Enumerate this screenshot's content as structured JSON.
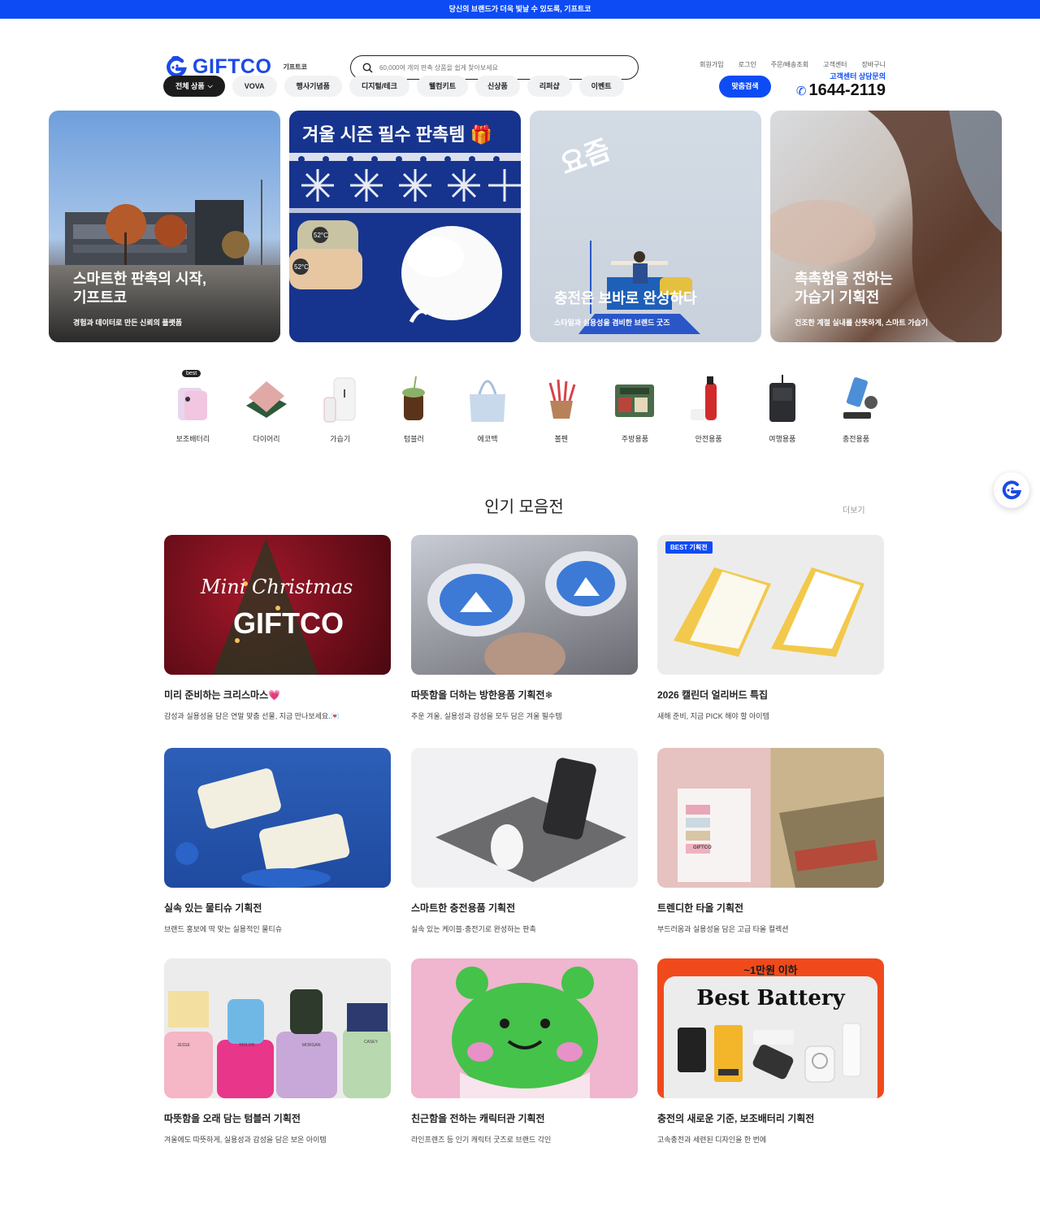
{
  "topbar": {
    "text": "당신의 브랜드가 더욱 빛날 수 있도록, 기프트코"
  },
  "header": {
    "logo_text": "GIFTCO",
    "logo_sub": "기프트코",
    "search_placeholder": "60,000여 개의 판촉 상품을 쉽게 찾아보세요",
    "util_links": [
      "회원가입",
      "로그인",
      "주문/배송조회",
      "고객센터",
      "장바구니"
    ],
    "nav": [
      "전체 상품",
      "VOVA",
      "행사기념품",
      "디지털/테크",
      "웰컴키트",
      "신상품",
      "리퍼샵",
      "이벤트"
    ],
    "match_button": "맞춤검색",
    "cs_label": "고객센터 상담문의",
    "cs_phone": "1644-2119"
  },
  "banners": [
    {
      "title": "스마트한 판촉의 시작,\n기프트코",
      "subtitle": "경험과 데이터로 만든 신뢰의 플랫폼"
    },
    {
      "title": "겨울 시즌 필수 판촉템",
      "subtitle": "",
      "temp1": "52°C",
      "temp2": "52°C"
    },
    {
      "title": "충전은 보바로 완성하다",
      "subtitle": "스타일과 실용성을 겸비한 브랜드 굿즈",
      "logo": "요즘"
    },
    {
      "title": "촉촉함을 전하는\n가습기 기획전",
      "subtitle": "건조한 계절 실내를 산뜻하게, 스마트 가습기"
    }
  ],
  "categories": {
    "best_badge": "best",
    "items": [
      "보조배터리",
      "다이어리",
      "가습기",
      "텀블러",
      "에코백",
      "볼펜",
      "주방용품",
      "안전용품",
      "여행용품",
      "충전용품"
    ]
  },
  "section": {
    "title": "인기 모음전",
    "more": "더보기"
  },
  "cards": [
    {
      "title": "미리 준비하는 크리스마스💗",
      "desc": "감성과 실용성을 담은 연말 맞춤 선물, 지금 만나보세요.💌",
      "img_script": "Mini Christmas",
      "img_brand": "GIFTCO"
    },
    {
      "title": "따뜻함을 더하는 방한용품 기획전❄",
      "desc": "추운 겨울, 실용성과 감성을 모두 담은 겨울 필수템"
    },
    {
      "title": "2026 캘린더 얼리버드 특집",
      "desc": "새해 준비, 지금 PICK 해야 할 아이템",
      "tag": "BEST 기획전"
    },
    {
      "title": "실속 있는 물티슈 기획전",
      "desc": "브랜드 홍보에 딱 맞는 실용적인 물티슈"
    },
    {
      "title": "스마트한 충전용품 기획전",
      "desc": "실속 있는 케이블·충전기로 완성하는 판촉"
    },
    {
      "title": "트렌디한 타올 기획전",
      "desc": "부드러움과 실용성을 담은 고급 타올 컬렉션",
      "img_brand": "GIFTCO"
    },
    {
      "title": "따뜻함을 오래 담는 텀블러 기획전",
      "desc": "겨울에도 따뜻하게, 실용성과 감성을 담은 보온 아이템",
      "tumbler_names": [
        "JESSE",
        "TAYLOR",
        "MORGAN",
        "CASEY"
      ]
    },
    {
      "title": "친근함을 전하는 캐릭터관 기획전",
      "desc": "라인프렌즈 등 인기 캐릭터 굿즈로 브랜드 각인"
    },
    {
      "title": "충전의 새로운 기준, 보조배터리 기획전",
      "desc": "고속충전과 세련된 디자인을 한 번에",
      "img_top": "~1만원 이하",
      "img_headline": "Best Battery"
    }
  ],
  "colors": {
    "brand_blue": "#0d4cf5",
    "dark_pill": "#1c1c1c"
  }
}
